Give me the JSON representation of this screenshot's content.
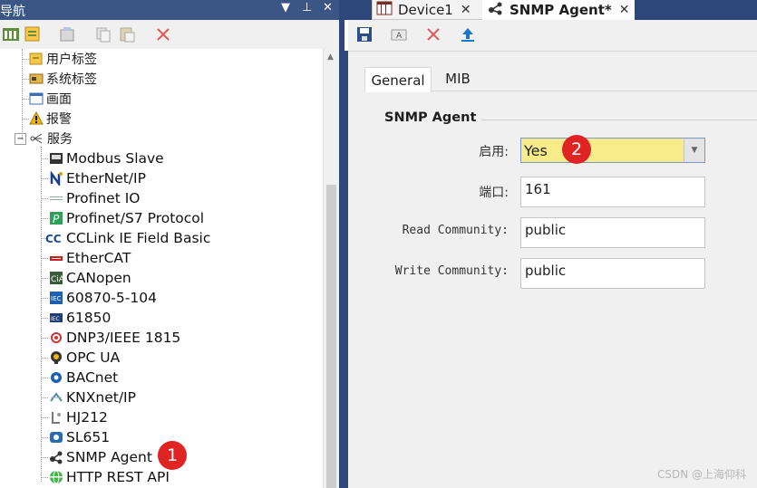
{
  "nav": {
    "title": "导航",
    "pin_icon": "pin-icon",
    "items": [
      {
        "label": "用户标签",
        "icon": "user-tag-icon"
      },
      {
        "label": "系统标签",
        "icon": "system-tag-icon"
      },
      {
        "label": "画面",
        "icon": "screen-icon"
      },
      {
        "label": "报警",
        "icon": "alarm-warning-icon"
      },
      {
        "label": "服务",
        "icon": "service-node-icon",
        "expanded": true
      }
    ],
    "services": [
      {
        "label": "Modbus Slave",
        "icon": "modbus-icon"
      },
      {
        "label": "EtherNet/IP",
        "icon": "ethernetip-icon"
      },
      {
        "label": "Profinet IO",
        "icon": "profinet-io-icon"
      },
      {
        "label": "Profinet/S7 Protocol",
        "icon": "profinet-s7-icon"
      },
      {
        "label": "CCLink IE Field Basic",
        "icon": "cclink-icon"
      },
      {
        "label": "EtherCAT",
        "icon": "ethercat-icon"
      },
      {
        "label": "CANopen",
        "icon": "canopen-icon"
      },
      {
        "label": "60870-5-104",
        "icon": "iec-104-icon"
      },
      {
        "label": "61850",
        "icon": "iec-61850-icon"
      },
      {
        "label": "DNP3/IEEE 1815",
        "icon": "dnp3-icon"
      },
      {
        "label": "OPC UA",
        "icon": "opcua-icon"
      },
      {
        "label": "BACnet",
        "icon": "bacnet-icon"
      },
      {
        "label": "KNXnet/IP",
        "icon": "knx-icon"
      },
      {
        "label": "HJ212",
        "icon": "hj212-icon"
      },
      {
        "label": "SL651",
        "icon": "sl651-icon"
      },
      {
        "label": "SNMP Agent",
        "icon": "snmp-icon"
      },
      {
        "label": "HTTP REST API",
        "icon": "http-rest-icon"
      }
    ]
  },
  "tabs": [
    {
      "label": "Device1",
      "close": "✕"
    },
    {
      "label": "SNMP Agent*",
      "close": "✕"
    }
  ],
  "editor": {
    "property_tabs": [
      "General",
      "MIB"
    ],
    "group_title": "SNMP Agent",
    "fields": {
      "enable": {
        "label": "启用:",
        "value": "Yes"
      },
      "port": {
        "label": "端口:",
        "value": "161"
      },
      "read_community": {
        "label": "Read Community:",
        "value": "public"
      },
      "write_community": {
        "label": "Write Community:",
        "value": "public"
      }
    }
  },
  "annotations": [
    "1",
    "2"
  ],
  "watermark": "CSDN @上海仰科",
  "colors": {
    "title_bar": "#3b5585",
    "frame": "#2d4779",
    "highlight": "#f8ec8a",
    "badge": "#e02424"
  }
}
